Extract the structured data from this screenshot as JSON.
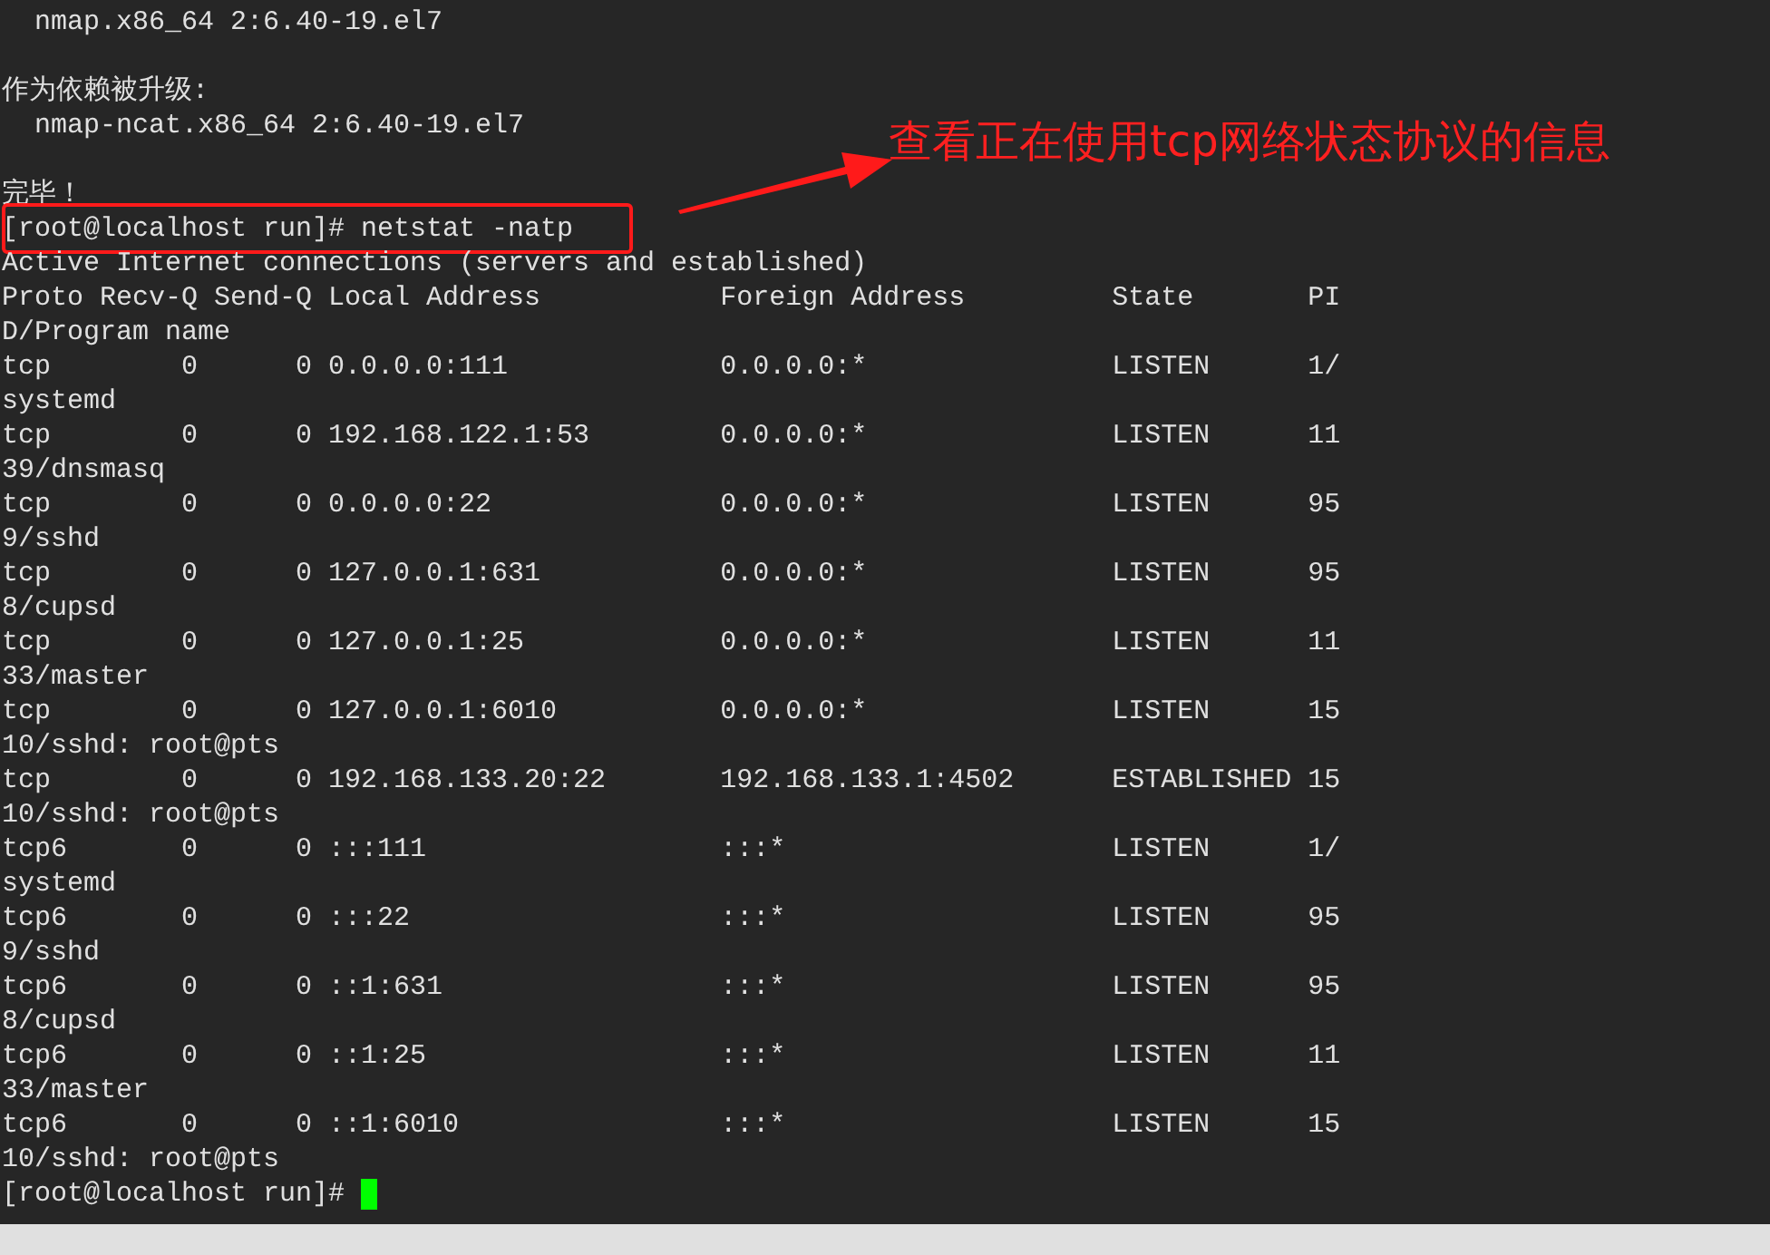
{
  "terminal": {
    "lines": [
      {
        "kind": "output",
        "text": "  nmap.x86_64 2:6.40-19.el7",
        "highlighted": false
      },
      {
        "kind": "blank"
      },
      {
        "kind": "output",
        "text": "作为依赖被升级:",
        "highlighted": false
      },
      {
        "kind": "output",
        "text": "  nmap-ncat.x86_64 2:6.40-19.el7",
        "highlighted": false
      },
      {
        "kind": "blank"
      },
      {
        "kind": "output",
        "text": "完毕！",
        "highlighted": false
      },
      {
        "kind": "output",
        "text": "[root@localhost run]# netstat -natp",
        "highlighted": true
      },
      {
        "kind": "output",
        "text": "Active Internet connections (servers and established)",
        "highlighted": false
      },
      {
        "kind": "output",
        "text": "Proto Recv-Q Send-Q Local Address           Foreign Address         State       PI",
        "highlighted": false
      },
      {
        "kind": "output",
        "text": "D/Program name",
        "highlighted": false
      },
      {
        "kind": "output",
        "text": "tcp        0      0 0.0.0.0:111             0.0.0.0:*               LISTEN      1/",
        "highlighted": false
      },
      {
        "kind": "output",
        "text": "systemd",
        "highlighted": false
      },
      {
        "kind": "output",
        "text": "tcp        0      0 192.168.122.1:53        0.0.0.0:*               LISTEN      11",
        "highlighted": false
      },
      {
        "kind": "output",
        "text": "39/dnsmasq",
        "highlighted": false
      },
      {
        "kind": "output",
        "text": "tcp        0      0 0.0.0.0:22              0.0.0.0:*               LISTEN      95",
        "highlighted": false
      },
      {
        "kind": "output",
        "text": "9/sshd",
        "highlighted": false
      },
      {
        "kind": "output",
        "text": "tcp        0      0 127.0.0.1:631           0.0.0.0:*               LISTEN      95",
        "highlighted": false
      },
      {
        "kind": "output",
        "text": "8/cupsd",
        "highlighted": false
      },
      {
        "kind": "output",
        "text": "tcp        0      0 127.0.0.1:25            0.0.0.0:*               LISTEN      11",
        "highlighted": false
      },
      {
        "kind": "output",
        "text": "33/master",
        "highlighted": false
      },
      {
        "kind": "output",
        "text": "tcp        0      0 127.0.0.1:6010          0.0.0.0:*               LISTEN      15",
        "highlighted": false
      },
      {
        "kind": "output",
        "text": "10/sshd: root@pts",
        "highlighted": false
      },
      {
        "kind": "output",
        "text": "tcp        0      0 192.168.133.20:22       192.168.133.1:4502      ESTABLISHED 15",
        "highlighted": false
      },
      {
        "kind": "output",
        "text": "10/sshd: root@pts",
        "highlighted": false
      },
      {
        "kind": "output",
        "text": "tcp6       0      0 :::111                  :::*                    LISTEN      1/",
        "highlighted": false
      },
      {
        "kind": "output",
        "text": "systemd",
        "highlighted": false
      },
      {
        "kind": "output",
        "text": "tcp6       0      0 :::22                   :::*                    LISTEN      95",
        "highlighted": false
      },
      {
        "kind": "output",
        "text": "9/sshd",
        "highlighted": false
      },
      {
        "kind": "output",
        "text": "tcp6       0      0 ::1:631                 :::*                    LISTEN      95",
        "highlighted": false
      },
      {
        "kind": "output",
        "text": "8/cupsd",
        "highlighted": false
      },
      {
        "kind": "output",
        "text": "tcp6       0      0 ::1:25                  :::*                    LISTEN      11",
        "highlighted": false
      },
      {
        "kind": "output",
        "text": "33/master",
        "highlighted": false
      },
      {
        "kind": "output",
        "text": "tcp6       0      0 ::1:6010                :::*                    LISTEN      15",
        "highlighted": false
      },
      {
        "kind": "output",
        "text": "10/sshd: root@pts",
        "highlighted": false
      },
      {
        "kind": "prompt",
        "text": "[root@localhost run]#",
        "cursor": true
      }
    ]
  },
  "annotation": {
    "text": "查看正在使用tcp网络状态协议的信息"
  }
}
